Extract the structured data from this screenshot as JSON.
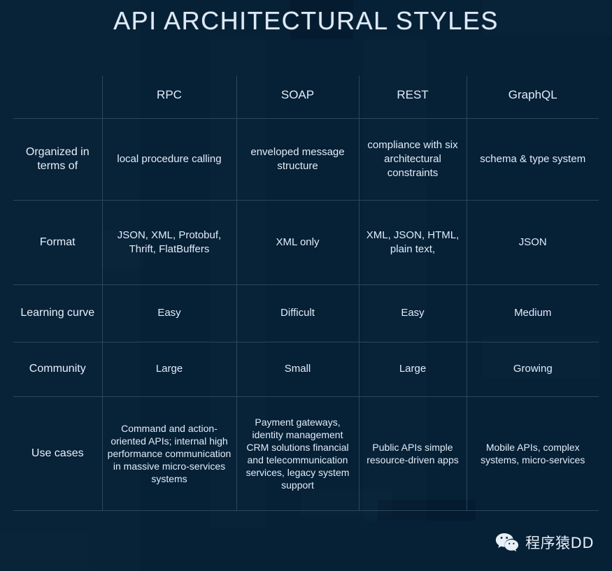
{
  "page": {
    "title": "API ARCHITECTURAL STYLES",
    "background_color": "#062036",
    "text_color": "#e2edf8"
  },
  "colors": {
    "green": "#8fc540",
    "red": "#f42b2b",
    "amber": "#f5bd10",
    "title": "#dfeaf6",
    "grid_line": "rgba(150,180,205,0.26)"
  },
  "table": {
    "corner_label": "",
    "columns": [
      "RPC",
      "SOAP",
      "REST",
      "GraphQL"
    ],
    "rows": [
      {
        "label": "Organized in terms of",
        "label_lines": [
          "Organized",
          "in terms of"
        ],
        "cells": [
          {
            "text": "local procedure calling",
            "color": "default"
          },
          {
            "text": "enveloped message structure",
            "color": "default"
          },
          {
            "text": "compliance with six architectural constraints",
            "color": "default"
          },
          {
            "text": "schema & type system",
            "color": "default"
          }
        ]
      },
      {
        "label": "Format",
        "label_lines": [
          "Format"
        ],
        "cells": [
          {
            "text": "JSON, XML, Protobuf, Thrift, FlatBuffers",
            "color": "default"
          },
          {
            "text": "XML only",
            "color": "red"
          },
          {
            "text": "XML, JSON, HTML, plain text,",
            "color": "default"
          },
          {
            "text": "JSON",
            "color": "default"
          }
        ]
      },
      {
        "label": "Learning curve",
        "label_lines": [
          "Learning",
          "curve"
        ],
        "cells": [
          {
            "text": "Easy",
            "color": "green"
          },
          {
            "text": "Difficult",
            "color": "red"
          },
          {
            "text": "Easy",
            "color": "green"
          },
          {
            "text": "Medium",
            "color": "amber"
          }
        ]
      },
      {
        "label": "Community",
        "label_lines": [
          "Community"
        ],
        "cells": [
          {
            "text": "Large",
            "color": "green"
          },
          {
            "text": "Small",
            "color": "red"
          },
          {
            "text": "Large",
            "color": "green"
          },
          {
            "text": "Growing",
            "color": "amber"
          }
        ]
      },
      {
        "label": "Use cases",
        "label_lines": [
          "Use cases"
        ],
        "cells": [
          {
            "text": "Command and action-oriented APIs; internal high performance communication in massive micro-services systems",
            "color": "default"
          },
          {
            "text": "Payment gateways, identity management CRM solutions financial and telecommunication services, legacy system support",
            "color": "default"
          },
          {
            "text": "Public APIs simple resource-driven apps",
            "color": "default"
          },
          {
            "text": "Mobile APIs, complex systems, micro-services",
            "color": "default"
          }
        ]
      }
    ]
  },
  "watermark": {
    "icon": "wechat-icon",
    "text": "程序猿DD"
  }
}
